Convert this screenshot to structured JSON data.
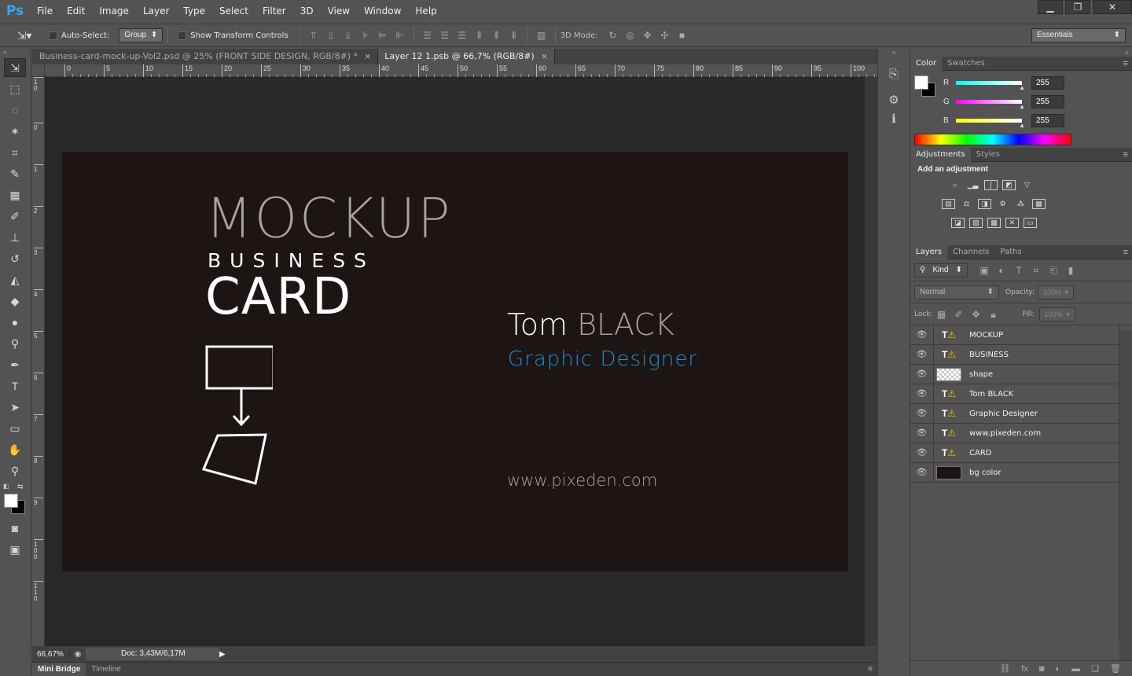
{
  "app": {
    "logo": "Ps"
  },
  "menu": [
    "File",
    "Edit",
    "Image",
    "Layer",
    "Type",
    "Select",
    "Filter",
    "3D",
    "View",
    "Window",
    "Help"
  ],
  "window_controls": {
    "minimize": "▁",
    "restore": "❐",
    "close": "✕"
  },
  "options": {
    "auto_select_label": "Auto-Select:",
    "auto_select_value": "Group",
    "show_transform_label": "Show Transform Controls",
    "mode_3d_label": "3D Mode:",
    "workspace": "Essentials"
  },
  "tabs": [
    {
      "label": "Business-card-mock-up-Vol2.psd @ 25% (FRONT SIDE DESIGN, RGB/8#) *",
      "close": "×"
    },
    {
      "label": "Layer 12 1.psb @ 66,7% (RGB/8#)",
      "close": "×"
    }
  ],
  "ruler_top": [
    "0",
    "5",
    "10",
    "15",
    "20",
    "25",
    "30",
    "35",
    "40",
    "45",
    "50",
    "55",
    "60",
    "65",
    "70",
    "75",
    "80",
    "85",
    "90",
    "95",
    "100"
  ],
  "ruler_left": [
    "1\n0",
    "0",
    "1",
    "2",
    "3",
    "4",
    "5",
    "6",
    "7",
    "8",
    "9",
    "1\n0\n0",
    "1\n1\n0"
  ],
  "card": {
    "mockup": "MOCKUP",
    "business": "BUSINESS",
    "card": "CARD",
    "name_first": "Tom",
    "name_last": "BLACK",
    "title": "Graphic Designer",
    "website": "www.pixeden.com",
    "bg_color": "#1d1514",
    "accent_color": "#1f8fcf"
  },
  "status": {
    "zoom": "66,67%",
    "doc": "Doc: 3,43M/6,17M"
  },
  "bottom_tabs": [
    "Mini Bridge",
    "Timeline"
  ],
  "color_panel": {
    "tabs": [
      "Color",
      "Swatches"
    ],
    "r_label": "R",
    "g_label": "G",
    "b_label": "B",
    "r": "255",
    "g": "255",
    "b": "255"
  },
  "adjustments_panel": {
    "tabs": [
      "Adjustments",
      "Styles"
    ],
    "heading": "Add an adjustment"
  },
  "layers_panel": {
    "tabs": [
      "Layers",
      "Channels",
      "Paths"
    ],
    "kind_label": "Kind",
    "blend_mode": "Normal",
    "opacity_label": "Opacity:",
    "opacity_value": "100%",
    "lock_label": "Lock:",
    "fill_label": "Fill:",
    "fill_value": "100%",
    "layers": [
      {
        "name": "MOCKUP",
        "type": "text"
      },
      {
        "name": "BUSINESS",
        "type": "text"
      },
      {
        "name": "shape",
        "type": "shape"
      },
      {
        "name": "Tom BLACK",
        "type": "text"
      },
      {
        "name": "Graphic Designer",
        "type": "text"
      },
      {
        "name": "www.pixeden.com",
        "type": "text"
      },
      {
        "name": "CARD",
        "type": "text"
      },
      {
        "name": "bg color",
        "type": "fill"
      }
    ]
  }
}
